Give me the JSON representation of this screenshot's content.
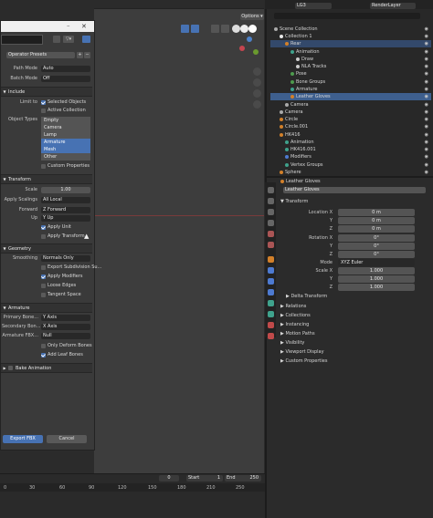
{
  "dialog": {
    "operator_presets": "Operator Presets",
    "path_mode_label": "Path Mode",
    "path_mode_value": "Auto",
    "batch_mode_label": "Batch Mode",
    "batch_mode_value": "Off",
    "include": {
      "title": "Include",
      "limit_to_label": "Limit to",
      "selected_objects": "Selected Objects",
      "active_collection": "Active Collection",
      "object_types_label": "Object Types",
      "object_types": [
        "Empty",
        "Camera",
        "Lamp",
        "Armature",
        "Mesh",
        "Other"
      ],
      "custom_properties": "Custom Properties"
    },
    "transform": {
      "title": "Transform",
      "scale_label": "Scale",
      "scale_value": "1.00",
      "apply_scalings_label": "Apply Scalings",
      "apply_scalings_value": "All Local",
      "forward_label": "Forward",
      "forward_value": "Z Forward",
      "up_label": "Up",
      "up_value": "Y Up",
      "apply_unit": "Apply Unit",
      "apply_transform": "Apply Transform"
    },
    "geometry": {
      "title": "Geometry",
      "smoothing_label": "Smoothing",
      "smoothing_value": "Normals Only",
      "export_subdivision": "Export Subdivision Su...",
      "apply_modifiers": "Apply Modifiers",
      "loose_edges": "Loose Edges",
      "tangent_space": "Tangent Space"
    },
    "armature": {
      "title": "Armature",
      "primary_bone_label": "Primary Bone...",
      "primary_bone_value": "Y Axis",
      "secondary_bone_label": "Secondary Bon...",
      "secondary_bone_value": "X Axis",
      "armature_fbx_label": "Armature FBX...",
      "armature_fbx_value": "Null",
      "only_deform": "Only Deform Bones",
      "add_leaf": "Add Leaf Bones"
    },
    "bake_animation": "Bake Animation",
    "export_button": "Export FBX",
    "cancel_button": "Cancel"
  },
  "viewport": {
    "options_label": "Options"
  },
  "timeline": {
    "current_frame": "0",
    "start_label": "Start",
    "start_value": "1",
    "end_label": "End",
    "end_value": "250",
    "ticks": [
      "0",
      "30",
      "60",
      "90",
      "120",
      "150",
      "180",
      "210",
      "250"
    ]
  },
  "topbar": {
    "scene_name": "LG3",
    "render_layer": "RenderLayer"
  },
  "outliner": {
    "rows": [
      {
        "label": "Scene Collection",
        "indent": 0
      },
      {
        "label": "Collection 1",
        "indent": 1
      },
      {
        "label": "Rear",
        "indent": 2
      },
      {
        "label": "Animation",
        "indent": 3
      },
      {
        "label": "Draw",
        "indent": 4
      },
      {
        "label": "NLA Tracks",
        "indent": 4
      },
      {
        "label": "Pose",
        "indent": 3
      },
      {
        "label": "Bone Groups",
        "indent": 3
      },
      {
        "label": "Armature",
        "indent": 3
      },
      {
        "label": "Leather Gloves",
        "indent": 3
      },
      {
        "label": "Camera",
        "indent": 2
      },
      {
        "label": "Camera",
        "indent": 1
      },
      {
        "label": "Circle",
        "indent": 1
      },
      {
        "label": "Circle.001",
        "indent": 1
      },
      {
        "label": "HK416",
        "indent": 1
      },
      {
        "label": "Animation",
        "indent": 2
      },
      {
        "label": "HK416.001",
        "indent": 2
      },
      {
        "label": "Modifiers",
        "indent": 2
      },
      {
        "label": "Vertex Groups",
        "indent": 2
      },
      {
        "label": "Sphere",
        "indent": 1
      }
    ]
  },
  "properties": {
    "object_name": "Leather Gloves",
    "object_field": "Leather Gloves",
    "transform_title": "Transform",
    "location": {
      "label": "Location X",
      "x": "0 m",
      "y": "0 m",
      "z": "0 m"
    },
    "rotation": {
      "label": "Rotation X",
      "x": "0°",
      "y": "0°",
      "z": "0°"
    },
    "mode_label": "Mode",
    "mode_value": "XYZ Euler",
    "scale": {
      "label": "Scale X",
      "x": "1.000",
      "y": "1.000",
      "z": "1.000"
    },
    "axis_y": "Y",
    "axis_z": "Z",
    "sections": [
      "Delta Transform",
      "Relations",
      "Collections",
      "Instancing",
      "Motion Paths",
      "Visibility",
      "Viewport Display",
      "Custom Properties"
    ]
  },
  "colors": {
    "accent": "#4772b3",
    "selection": "#33496b"
  }
}
